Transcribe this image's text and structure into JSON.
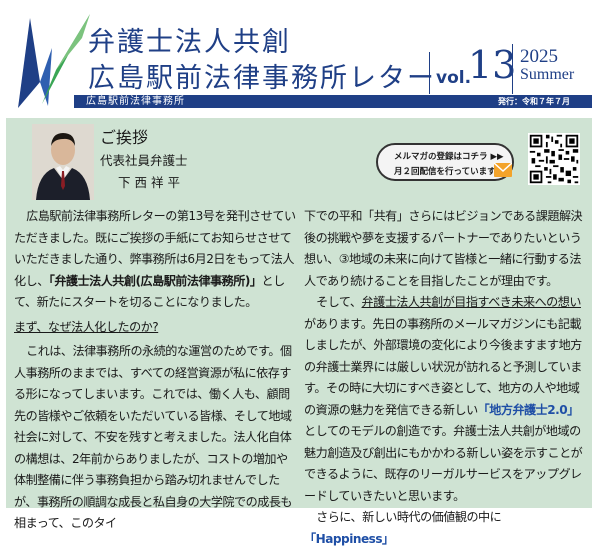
{
  "header": {
    "title_line1": "弁護士法人共創",
    "title_line2": "広島駅前法律事務所レター",
    "vol_label": "vol.",
    "vol_number": "13",
    "year": "2025",
    "season": "Summer",
    "bar_firm": "広島駅前法律事務所",
    "issue_date": "発行：令和７年７月",
    "accent_colors": {
      "navy": "#1f3f86",
      "green": "#3aa655",
      "panel": "#cfe3d3"
    }
  },
  "greeting": {
    "title": "ご挨拶",
    "role": "代表社員弁護士",
    "name": "下西祥平"
  },
  "newsletter": {
    "line1": "メルマガの登録はコチラ ▶▶",
    "line2": "月２回配信を行っています。",
    "icon": "envelope-icon"
  },
  "col1": {
    "p1_a": "広島駅前法律事務所レターの第13号を発刊させていただきました。既にご挨拶の手紙にてお知らせさせていただきました通り、弊事務所は6月2日をもって法人化し、",
    "p1_b": "「弁護士法人共創(広島駅前法律事務所)」",
    "p1_c": "として、新たにスタートを切ることになりました。",
    "q": "まず、なぜ法人化したのか?",
    "p2": "これは、法律事務所の永続的な運営のためです。個人事務所のままでは、すべての経営資源が私に依存する形になってしまいます。これでは、働く人も、顧問先の皆様やご依頼をいただいている皆様、そして地域社会に対して、不安を残すと考えました。法人化自体の構想は、2年前からありましたが、コストの増加や体制整備に伴う事務負担から踏み切れませんでしたが、事務所の順調な成長と私自身の大学院での成長も相まって、このタイ"
  },
  "col2": {
    "p1": "下での平和「共有」さらにはビジョンである課題解決後の挑戦や夢を支援するパートナーでありたいという想い、③地域の未来に向けて皆様と一緒に行動する法人であり続けることを目指したことが理由です。",
    "p2_a": "そして、",
    "p2_b": "弁護士法人共創が目指すべき未来への想い",
    "p2_c": "があります。先日の事務所のメールマガジンにも記載しましたが、外部環境の変化により今後ますます地方の弁護士業界には厳しい状況が訪れると予測しています。その時に大切にすべき姿として、地方の人や地域の資源の魅力を発信できる新しい",
    "p2_d": "「地方弁護士2.0」",
    "p2_e": "としてのモデルの創造です。弁護士法人共創が地域の魅力創造及び創出にもかかわる新しい姿を示すことができるように、既存のリーガルサービスをアップグレードしていきたいと思います。",
    "p3_a": "さらに、新しい時代の価値観の中に",
    "p3_b": "「Happiness」"
  }
}
